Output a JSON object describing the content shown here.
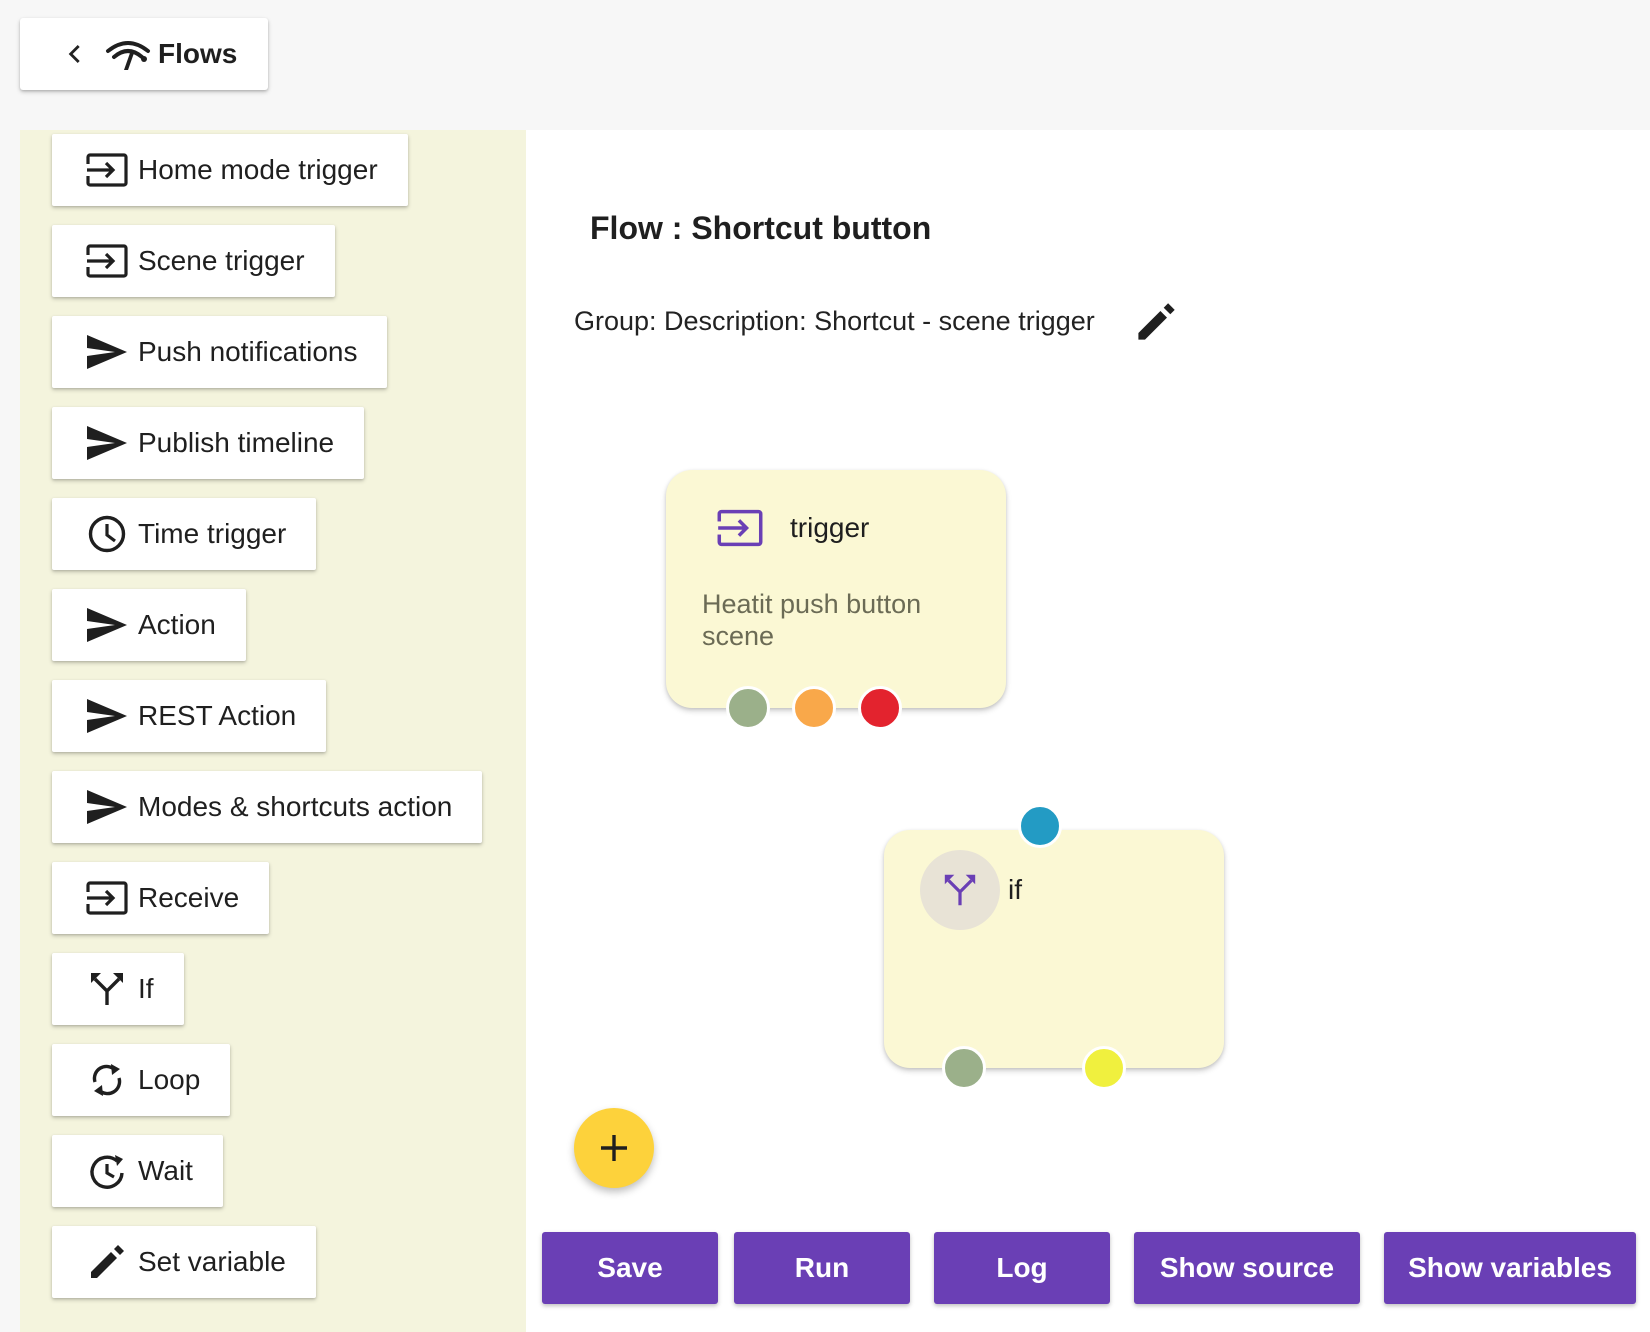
{
  "header": {
    "back_label": "Flows"
  },
  "sidebar": {
    "items": [
      {
        "label": "Home mode trigger",
        "icon": "login-icon"
      },
      {
        "label": "Scene trigger",
        "icon": "login-icon"
      },
      {
        "label": "Push notifications",
        "icon": "send-icon"
      },
      {
        "label": "Publish timeline",
        "icon": "send-icon"
      },
      {
        "label": "Time trigger",
        "icon": "clock-icon"
      },
      {
        "label": "Action",
        "icon": "send-icon"
      },
      {
        "label": "REST Action",
        "icon": "send-icon"
      },
      {
        "label": "Modes & shortcuts action",
        "icon": "send-icon"
      },
      {
        "label": "Receive",
        "icon": "login-icon"
      },
      {
        "label": "If",
        "icon": "call-split-icon"
      },
      {
        "label": "Loop",
        "icon": "sync-icon"
      },
      {
        "label": "Wait",
        "icon": "timer-icon"
      },
      {
        "label": "Set variable",
        "icon": "pencil-icon"
      }
    ]
  },
  "main": {
    "flow_title": "Flow : Shortcut button",
    "group_description": "Group: Description: Shortcut - scene trigger"
  },
  "nodes": {
    "trigger": {
      "title": "trigger",
      "description": "Heatit push button scene"
    },
    "if": {
      "title": "if"
    }
  },
  "actions": {
    "save": "Save",
    "run": "Run",
    "log": "Log",
    "show_source": "Show source",
    "show_variables": "Show variables"
  },
  "colors": {
    "accent": "#6a3fb5",
    "fab": "#fdd23b",
    "sidebar_bg": "#f4f4dd",
    "node_bg": "#fbf8d4",
    "port_green": "#9bb08a",
    "port_orange": "#f9a84a",
    "port_red": "#e3232e",
    "port_blue": "#239bc4",
    "port_yellow": "#f0f03e"
  }
}
